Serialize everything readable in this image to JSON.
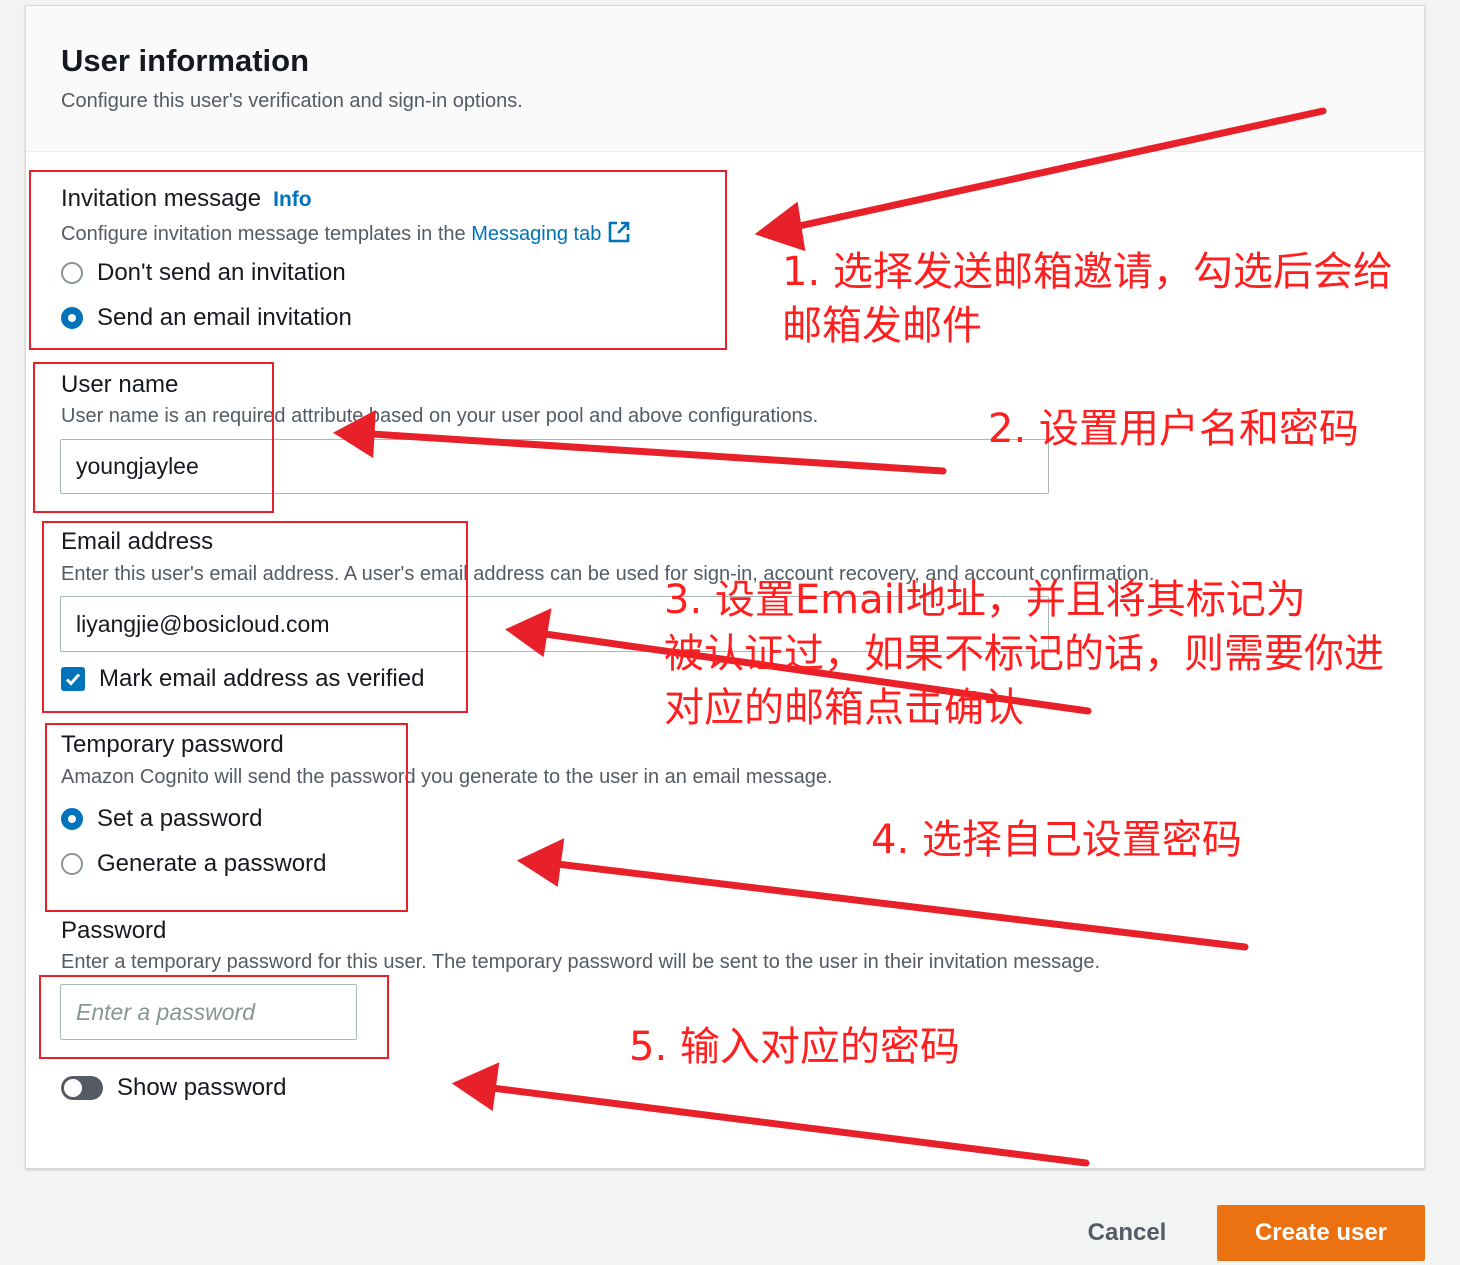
{
  "header": {
    "title": "User information",
    "subtitle": "Configure this user's verification and sign-in options."
  },
  "invitation": {
    "label": "Invitation message",
    "info": "Info",
    "desc_prefix": "Configure invitation message templates in the ",
    "desc_link": "Messaging tab",
    "options": [
      "Don't send an invitation",
      "Send an email invitation"
    ],
    "selected": "Send an email invitation"
  },
  "username": {
    "label": "User name",
    "desc": "User name is an required attribute based on your user pool and above configurations.",
    "value": "youngjaylee"
  },
  "email": {
    "label": "Email address",
    "desc": "Enter this user's email address. A user's email address can be used for sign-in, account recovery, and account confirmation.",
    "value": "liyangjie@bosicloud.com",
    "verified_label": "Mark email address as verified",
    "verified": true
  },
  "temp_password": {
    "label": "Temporary password",
    "desc": "Amazon Cognito will send the password you generate to the user in an email message.",
    "options": [
      "Set a password",
      "Generate a password"
    ],
    "selected": "Set a password"
  },
  "password": {
    "label": "Password",
    "desc": "Enter a temporary password for this user. The temporary password will be sent to the user in their invitation message.",
    "placeholder": "Enter a password",
    "value": "",
    "show_label": "Show password",
    "show": false
  },
  "footer": {
    "cancel": "Cancel",
    "create": "Create user"
  },
  "annotations": {
    "a1_line1": "1. 选择发送邮箱邀请，勾选后会给",
    "a1_line2": "邮箱发邮件",
    "a2": "2. 设置用户名和密码",
    "a3_line1": "3. 设置Email地址，并且将其标记为",
    "a3_line2": "被认证过，如果不标记的话，则需要你进",
    "a3_line3": "对应的邮箱点击确认",
    "a4": "4. 选择自己设置密码",
    "a5": "5. 输入对应的密码",
    "color": "#ff1f1f"
  },
  "colors": {
    "primary": "#ec7211",
    "link": "#0073bb",
    "annotation": "#e8202a"
  }
}
